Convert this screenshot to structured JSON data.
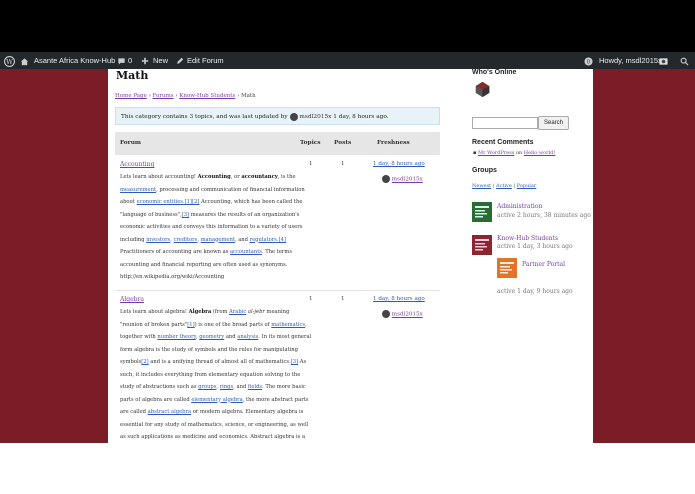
{
  "adminbar": {
    "site_name": "Asante Africa Know-Hub",
    "comments_count": "0",
    "new_label": "New",
    "edit_label": "Edit Forum",
    "howdy": "Howdy, msdl2015x"
  },
  "page": {
    "title": "Math",
    "breadcrumbs": [
      "Home Page",
      "Forums",
      "Know-Hub Students",
      "Math"
    ],
    "notice": {
      "prefix": "This category contains 3 topics, and was last updated by",
      "user": "msdl2015x",
      "suffix": "1 day, 8 hours ago."
    },
    "table_headers": {
      "forum": "Forum",
      "topics": "Topics",
      "posts": "Posts",
      "freshness": "Freshness"
    },
    "forums": [
      {
        "name": "Accounting",
        "topics": "1",
        "posts": "1",
        "freshness": "1 day, 8 hours ago",
        "user": "msdl2015x",
        "lines": [
          [
            {
              "t": "Lets learn about accounting! "
            },
            {
              "t": "Accounting",
              "b": true
            },
            {
              "t": ", or "
            },
            {
              "t": "accountancy",
              "b": true
            },
            {
              "t": ", is the"
            }
          ],
          [
            {
              "t": "measurement",
              "l": true
            },
            {
              "t": ", processing and communication of financial information"
            }
          ],
          [
            {
              "t": "about "
            },
            {
              "t": "economic entities",
              "l": true
            },
            {
              "t": ".[1][2]",
              "l": true
            },
            {
              "t": " Accounting, which has been called the"
            }
          ],
          [
            {
              "t": "\"language of business\","
            },
            {
              "t": "[3]",
              "l": true
            },
            {
              "t": " measures the results of an organization's"
            }
          ],
          [
            {
              "t": "economic activities and conveys this information to a variety of users"
            }
          ],
          [
            {
              "t": "including "
            },
            {
              "t": "investors",
              "l": true
            },
            {
              "t": ", "
            },
            {
              "t": "creditors",
              "l": true
            },
            {
              "t": ", "
            },
            {
              "t": "management",
              "l": true
            },
            {
              "t": ", and "
            },
            {
              "t": "regulators",
              "l": true
            },
            {
              "t": ".[4]",
              "l": true
            }
          ],
          [
            {
              "t": "Practitioners of accounting are known as "
            },
            {
              "t": "accountants",
              "l": true
            },
            {
              "t": ". The terms"
            }
          ],
          [
            {
              "t": "accounting and financial reporting are often used as synonyms."
            }
          ],
          [
            {
              "t": "http://en.wikipedia.org/wiki/Accounting"
            }
          ]
        ]
      },
      {
        "name": "Algebra",
        "topics": "1",
        "posts": "1",
        "freshness": "1 day, 8 hours ago",
        "user": "msdl2015x",
        "lines": [
          [
            {
              "t": "Lets learn about algebra! "
            },
            {
              "t": "Algebra",
              "b": true
            },
            {
              "t": " (from "
            },
            {
              "t": "Arabic",
              "l": true
            },
            {
              "t": " al-jebr",
              "i": true
            },
            {
              "t": " meaning"
            }
          ],
          [
            {
              "t": "\"reunion of broken parts\""
            },
            {
              "t": "[1]",
              "l": true
            },
            {
              "t": ") is one of the broad parts of "
            },
            {
              "t": "mathematics",
              "l": true
            },
            {
              "t": ","
            }
          ],
          [
            {
              "t": "together with "
            },
            {
              "t": "number theory",
              "l": true
            },
            {
              "t": ", "
            },
            {
              "t": "geometry",
              "l": true
            },
            {
              "t": " and "
            },
            {
              "t": "analysis",
              "l": true
            },
            {
              "t": ". In its most general"
            }
          ],
          [
            {
              "t": "form algebra is the study of symbols and the rules for manipulating"
            }
          ],
          [
            {
              "t": "symbols"
            },
            {
              "t": "[2]",
              "l": true
            },
            {
              "t": " and is a unifying thread of almost all of mathematics."
            },
            {
              "t": "[3]",
              "l": true
            },
            {
              "t": " As"
            }
          ],
          [
            {
              "t": "such, it includes everything from elementary equation solving to the"
            }
          ],
          [
            {
              "t": "study of abstractions such as "
            },
            {
              "t": "groups",
              "l": true
            },
            {
              "t": ", "
            },
            {
              "t": "rings",
              "l": true
            },
            {
              "t": ", and "
            },
            {
              "t": "fields",
              "l": true
            },
            {
              "t": ". The more basic"
            }
          ],
          [
            {
              "t": "parts of algebra are called "
            },
            {
              "t": "elementary algebra",
              "l": true
            },
            {
              "t": ", the more abstract parts"
            }
          ],
          [
            {
              "t": "are called "
            },
            {
              "t": "abstract algebra",
              "l": true
            },
            {
              "t": " or modern algebra. Elementary algebra is"
            }
          ],
          [
            {
              "t": "essential for any study of mathematics, science, or engineering, as well"
            }
          ],
          [
            {
              "t": "as such applications as medicine and economics. Abstract algebra is a"
            }
          ]
        ]
      }
    ]
  },
  "sidebar": {
    "whos_online": "Who's Online",
    "search_button": "Search",
    "recent_comments_title": "Recent Comments",
    "recent_comment": {
      "author": "Mr WordPress",
      "on": "on",
      "post": "Hello world!"
    },
    "groups_title": "Groups",
    "group_tabs": [
      "Newest",
      "Active",
      "Popular"
    ],
    "groups": [
      {
        "name": "Administration",
        "activity": "active 2 hours, 38 minutes ago",
        "color": "#2e6b34"
      },
      {
        "name": "Know-Hub Students",
        "activity": "active 1 day, 3 hours ago",
        "color": "#8b2630"
      },
      {
        "name": "Partner Portal",
        "activity": "active 1 day, 9 hours ago",
        "color": "#e0752a"
      }
    ]
  }
}
